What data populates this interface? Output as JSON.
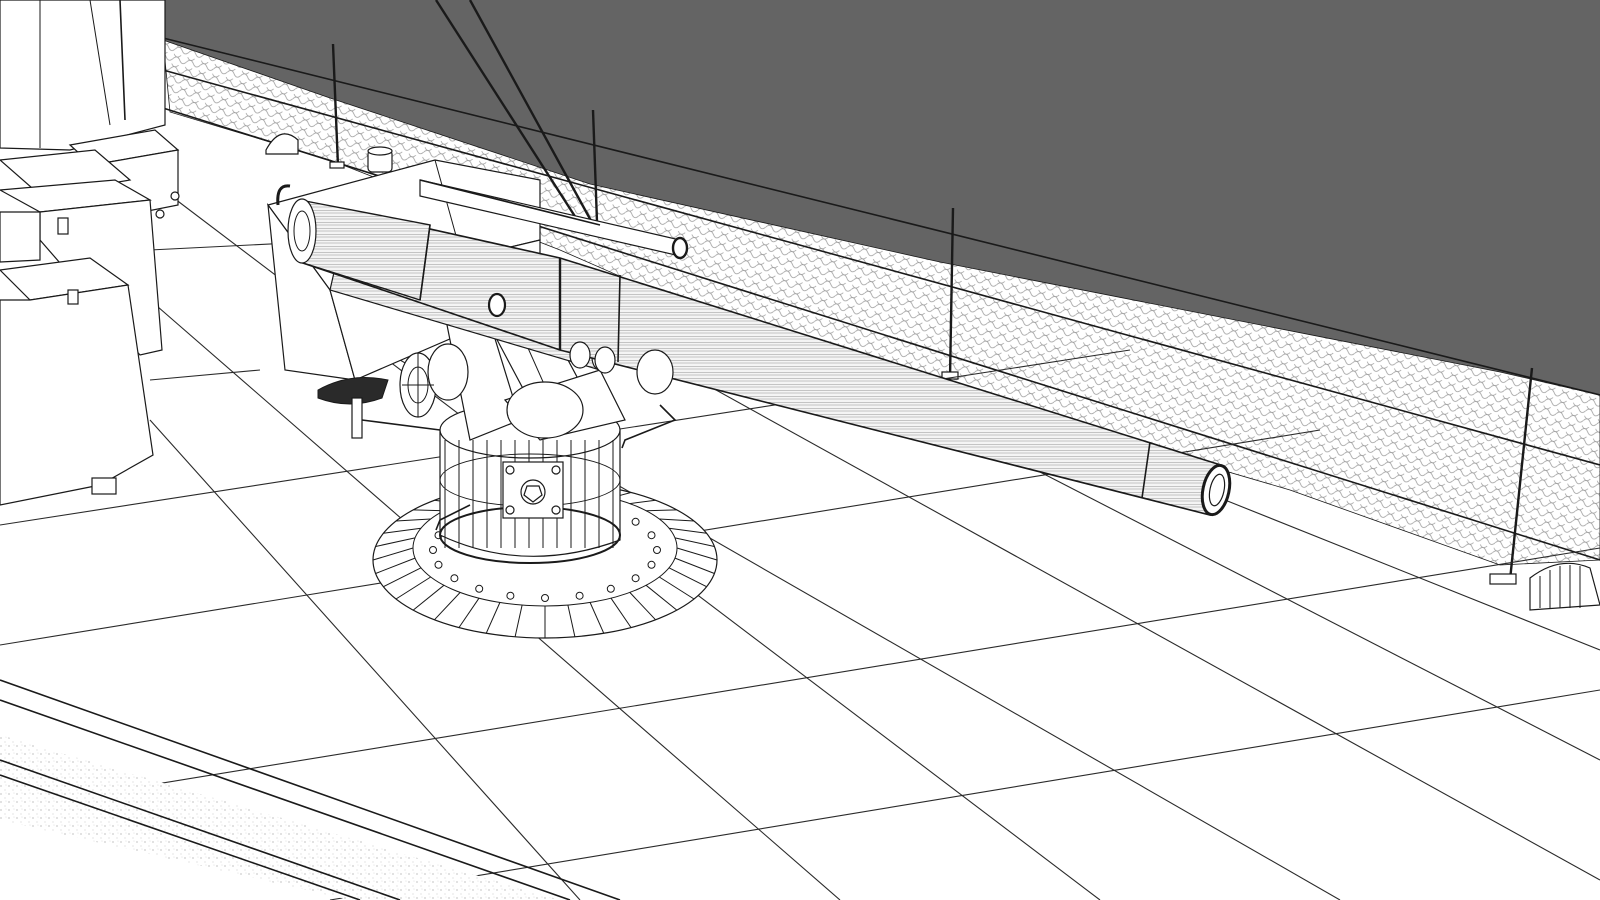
{
  "scene": {
    "colors": {
      "background": "#ffffff",
      "hull_wall": "#646464",
      "line": "#1a1a1a",
      "mesh": "#9a9a9a",
      "deck_grid": "#2a2a2a"
    }
  }
}
